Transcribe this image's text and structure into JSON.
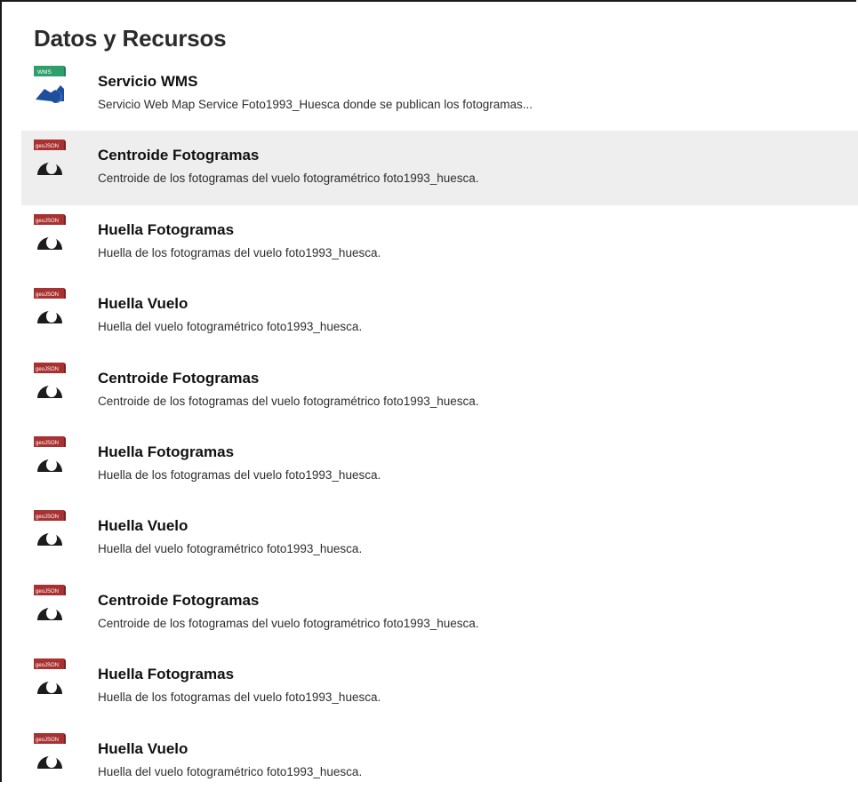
{
  "section": {
    "title": "Datos y Recursos"
  },
  "resources": [
    {
      "format_badge": "WMS",
      "icon": "wms-service-icon",
      "title": "Servicio WMS",
      "description": "Servicio Web Map Service Foto1993_Huesca donde se publican los fotogramas..."
    },
    {
      "format_badge": "geoJSON",
      "icon": "geojson-file-icon",
      "title": "Centroide Fotogramas",
      "description": "Centroide de los fotogramas del vuelo fotogramétrico foto1993_huesca."
    },
    {
      "format_badge": "geoJSON",
      "icon": "geojson-file-icon",
      "title": "Huella Fotogramas",
      "description": "Huella de los fotogramas del vuelo foto1993_huesca."
    },
    {
      "format_badge": "geoJSON",
      "icon": "geojson-file-icon",
      "title": "Huella Vuelo",
      "description": "Huella del vuelo fotogramétrico foto1993_huesca."
    },
    {
      "format_badge": "geoJSON",
      "icon": "geojson-file-icon",
      "title": "Centroide Fotogramas",
      "description": "Centroide de los fotogramas del vuelo fotogramétrico foto1993_huesca."
    },
    {
      "format_badge": "geoJSON",
      "icon": "geojson-file-icon",
      "title": "Huella Fotogramas",
      "description": "Huella de los fotogramas del vuelo foto1993_huesca."
    },
    {
      "format_badge": "geoJSON",
      "icon": "geojson-file-icon",
      "title": "Huella Vuelo",
      "description": "Huella del vuelo fotogramétrico foto1993_huesca."
    },
    {
      "format_badge": "geoJSON",
      "icon": "geojson-file-icon",
      "title": "Centroide Fotogramas",
      "description": "Centroide de los fotogramas del vuelo fotogramétrico foto1993_huesca."
    },
    {
      "format_badge": "geoJSON",
      "icon": "geojson-file-icon",
      "title": "Huella Fotogramas",
      "description": "Huella de los fotogramas del vuelo foto1993_huesca."
    },
    {
      "format_badge": "geoJSON",
      "icon": "geojson-file-icon",
      "title": "Huella Vuelo",
      "description": "Huella del vuelo fotogramétrico foto1993_huesca."
    }
  ],
  "colors": {
    "wms_badge": "#2e9e6a",
    "wms_shape": "#1f4f9c",
    "geojson_badge": "#a83232",
    "geojson_shape": "#1c1c1c",
    "highlight_row": "#eeeeee"
  }
}
